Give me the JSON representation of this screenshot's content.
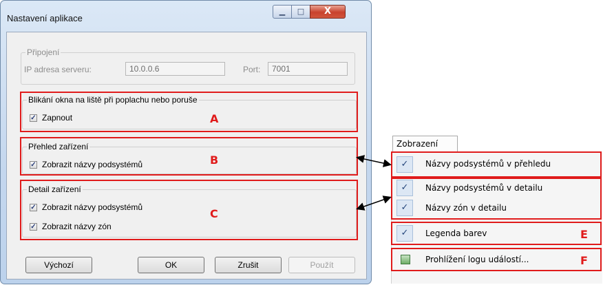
{
  "window": {
    "title": "Nastavení aplikace",
    "minimize_glyph": "▁",
    "maximize_glyph": "□",
    "close_glyph": "X"
  },
  "connection": {
    "legend": "Připojení",
    "ip_label": "IP adresa serveru:",
    "ip_value": "10.0.0.6",
    "port_label": "Port:",
    "port_value": "7001"
  },
  "blink_group": {
    "legend": "Blikání okna na liště při poplachu nebo poruše",
    "checkbox_label": "Zapnout",
    "checked": true,
    "marker": "A"
  },
  "overview_group": {
    "legend": "Přehled zařízení",
    "checkbox_label": "Zobrazit názvy podsystémů",
    "checked": true,
    "marker": "B"
  },
  "detail_group": {
    "legend": "Detail zařízení",
    "checkbox1_label": "Zobrazit názvy podsystémů",
    "checkbox2_label": "Zobrazit názvy zón",
    "marker": "C"
  },
  "buttons": {
    "default": "Výchozí",
    "ok": "OK",
    "cancel": "Zrušit",
    "apply": "Použít"
  },
  "menu": {
    "tab": "Zobrazení",
    "check_glyph": "✓",
    "items": [
      {
        "label": "Názvy podsystémů v přehledu",
        "checked": true
      },
      {
        "label": "Názvy podsystémů v detailu",
        "checked": true
      },
      {
        "label": "Názvy zón v detailu",
        "checked": true
      },
      {
        "label": "Legenda barev",
        "checked": true,
        "marker": "E"
      },
      {
        "label": "Prohlížení logu událostí...",
        "icon": "log-icon",
        "marker": "F"
      }
    ]
  },
  "colors": {
    "highlight": "#e01b1b",
    "window_frame": "#c4d7ee",
    "client_bg": "#f0f0f0"
  }
}
